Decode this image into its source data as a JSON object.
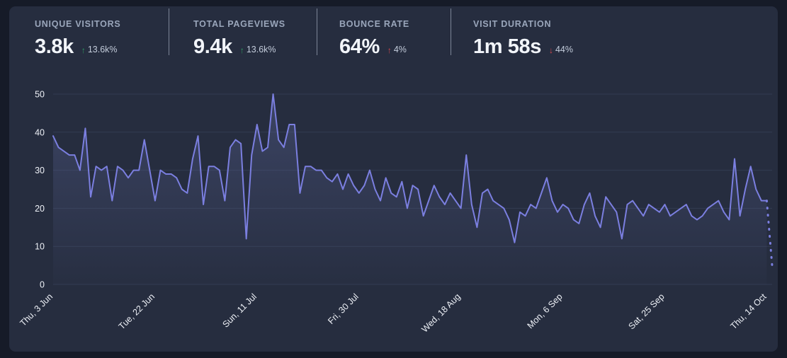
{
  "stats": [
    {
      "label": "UNIQUE VISITORS",
      "value": "3.8k",
      "delta": "13.6k%",
      "direction": "up",
      "arrow": "↑",
      "color": "#2e9e63",
      "name": "unique-visitors"
    },
    {
      "label": "TOTAL PAGEVIEWS",
      "value": "9.4k",
      "delta": "13.6k%",
      "direction": "up",
      "arrow": "↑",
      "color": "#2e9e63",
      "name": "total-pageviews"
    },
    {
      "label": "BOUNCE RATE",
      "value": "64%",
      "delta": "4%",
      "direction": "up",
      "arrow": "↑",
      "color": "#d8474d",
      "name": "bounce-rate"
    },
    {
      "label": "VISIT DURATION",
      "value": "1m 58s",
      "delta": "44%",
      "direction": "down",
      "arrow": "↓",
      "color": "#d8474d",
      "name": "visit-duration"
    }
  ],
  "colors": {
    "page_background": "#161b28",
    "panel_background": "#262d3f",
    "line": "#7b7fe0",
    "area_fill": "#5a6496",
    "gridline": "#333c52",
    "tick_text": "#eef1f7",
    "label_text": "#9aa6bb",
    "value_text": "#f2f5fa",
    "up": "#2e9e63",
    "down": "#d8474d"
  },
  "chart_data": {
    "type": "line",
    "title": "",
    "xlabel": "",
    "ylabel": "",
    "ylim": [
      0,
      50
    ],
    "yticks": [
      0,
      10,
      20,
      30,
      40,
      50
    ],
    "grid": true,
    "legend": "none",
    "tick_label_rotation": -45,
    "xtick_labels": [
      "Thu, 3 Jun",
      "Tue, 22 Jun",
      "Sun, 11 Jul",
      "Fri, 30 Jul",
      "Wed, 18 Aug",
      "Mon, 6 Sep",
      "Sat, 25 Sep",
      "Thu, 14 Oct"
    ],
    "xtick_indices": [
      0,
      19,
      38,
      57,
      76,
      95,
      114,
      133
    ],
    "series": [
      {
        "name": "Unique visitors",
        "dashed_tail": true,
        "dashed_tail_note": "final segment drawn dotted (incomplete/projected day)",
        "values": [
          39,
          36,
          35,
          34,
          34,
          30,
          41,
          23,
          31,
          30,
          31,
          22,
          31,
          30,
          28,
          30,
          30,
          38,
          30,
          22,
          30,
          29,
          29,
          28,
          25,
          24,
          33,
          39,
          21,
          31,
          31,
          30,
          22,
          36,
          38,
          37,
          12,
          34,
          42,
          35,
          36,
          50,
          38,
          36,
          42,
          42,
          24,
          31,
          31,
          30,
          30,
          28,
          27,
          29,
          25,
          29,
          26,
          24,
          26,
          30,
          25,
          22,
          28,
          24,
          23,
          27,
          20,
          26,
          25,
          18,
          22,
          26,
          23,
          21,
          24,
          22,
          20,
          34,
          21,
          15,
          24,
          25,
          22,
          21,
          20,
          17,
          11,
          19,
          18,
          21,
          20,
          24,
          28,
          22,
          19,
          21,
          20,
          17,
          16,
          21,
          24,
          18,
          15,
          23,
          21,
          19,
          12,
          21,
          22,
          20,
          18,
          21,
          20,
          19,
          21,
          18,
          19,
          20,
          21,
          18,
          17,
          18,
          20,
          21,
          22,
          19,
          17,
          33,
          18,
          25,
          31,
          25,
          22,
          22,
          5
        ]
      }
    ]
  }
}
